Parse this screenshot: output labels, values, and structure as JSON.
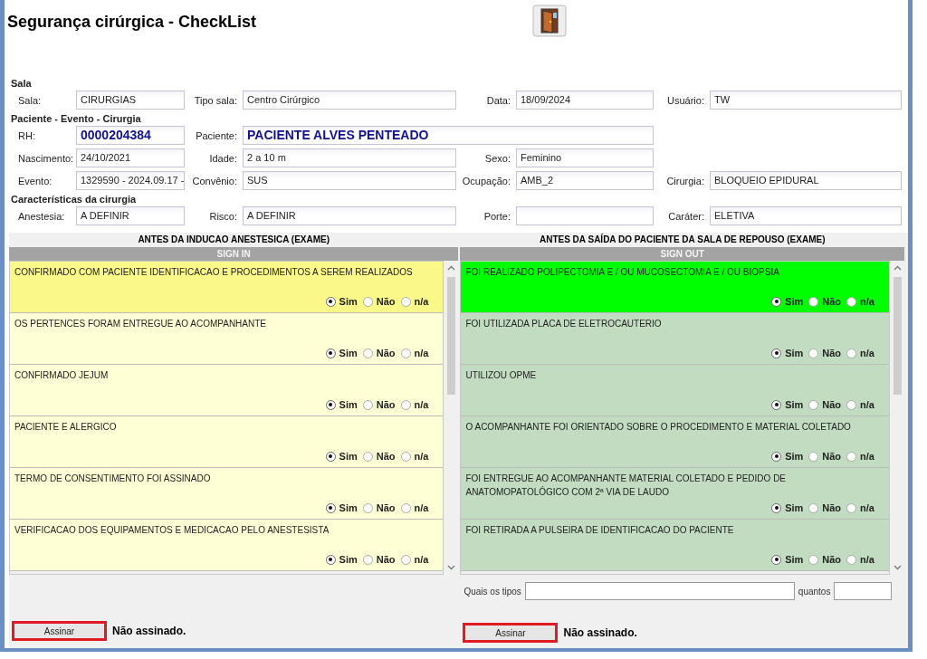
{
  "window": {
    "title": "Segurança cirúrgica - CheckList"
  },
  "form": {
    "sections": [
      {
        "title": "Sala",
        "rows": [
          [
            {
              "label": "Sala:",
              "value": "CIRURGIAS",
              "kind": "plain"
            },
            {
              "label": "Tipo sala:",
              "value": "Centro Cirúrgico",
              "kind": "plain"
            },
            {
              "label": "Data:",
              "value": "18/09/2024",
              "kind": "plain"
            },
            {
              "label": "Usuário:",
              "value": "TW",
              "kind": "plain"
            }
          ]
        ]
      },
      {
        "title": "Paciente - Evento - Cirurgia",
        "rows": [
          [
            {
              "label": "RH:",
              "value": "0000204384",
              "kind": "highlight"
            },
            {
              "label": "Paciente:",
              "value": "PACIENTE ALVES PENTEADO",
              "kind": "highlight"
            }
          ],
          [
            {
              "label": "Nascimento:",
              "value": "24/10/2021",
              "kind": "plain"
            },
            {
              "label": "Idade:",
              "value": "2 a 10 m",
              "kind": "plain"
            },
            {
              "label": "Sexo:",
              "value": "Feminino",
              "kind": "plain"
            }
          ],
          [
            {
              "label": "Evento:",
              "value": "1329590 - 2024.09.17 -",
              "kind": "plain"
            },
            {
              "label": "Convênio:",
              "value": "SUS",
              "kind": "plain"
            },
            {
              "label": "Ocupação:",
              "value": "AMB_2",
              "kind": "plain"
            },
            {
              "label": "Cirurgia:",
              "value": "BLOQUEIO EPIDURAL",
              "kind": "plain"
            }
          ]
        ]
      },
      {
        "title": "Características da cirurgia",
        "rows": [
          [
            {
              "label": "Anestesia:",
              "value": "A DEFINIR",
              "kind": "plain"
            },
            {
              "label": "Risco:",
              "value": "A DEFINIR",
              "kind": "plain"
            },
            {
              "label": "Porte:",
              "kind": "plain"
            },
            {
              "label": "Caráter:",
              "value": "ELETIVA",
              "kind": "plain"
            }
          ]
        ]
      }
    ]
  },
  "panels": [
    {
      "kind": "sign-in",
      "title": "ANTES DA INDUCAO ANESTESICA (EXAME)",
      "subtitle": "SIGN IN",
      "items": [
        {
          "text": "CONFIRMADO COM PACIENTE IDENTIFICACAO E PROCEDIMENTOS A SEREM REALIZADOS",
          "highlighted": true,
          "options": [
            {
              "label": "Sim",
              "selected": true
            },
            {
              "label": "Não",
              "selected": false
            },
            {
              "label": "n/a",
              "selected": false
            }
          ]
        },
        {
          "text": "OS PERTENCES FORAM ENTREGUE AO ACOMPANHANTE",
          "highlighted": false,
          "options": [
            {
              "label": "Sim",
              "selected": true
            },
            {
              "label": "Não",
              "selected": false
            },
            {
              "label": "n/a",
              "selected": false
            }
          ]
        },
        {
          "text": "CONFIRMADO JEJUM",
          "highlighted": false,
          "options": [
            {
              "label": "Sim",
              "selected": true
            },
            {
              "label": "Não",
              "selected": false
            },
            {
              "label": "n/a",
              "selected": false
            }
          ]
        },
        {
          "text": "PACIENTE E ALERGICO",
          "highlighted": false,
          "options": [
            {
              "label": "Sim",
              "selected": true
            },
            {
              "label": "Não",
              "selected": false
            },
            {
              "label": "n/a",
              "selected": false
            }
          ]
        },
        {
          "text": "TERMO DE CONSENTIMENTO FOI ASSINADO",
          "highlighted": false,
          "options": [
            {
              "label": "Sim",
              "selected": true
            },
            {
              "label": "Não",
              "selected": false
            },
            {
              "label": "n/a",
              "selected": false
            }
          ]
        },
        {
          "text": "VERIFICACAO DOS EQUIPAMENTOS E MEDICACAO PELO ANESTESISTA",
          "highlighted": false,
          "options": [
            {
              "label": "Sim",
              "selected": true
            },
            {
              "label": "Não",
              "selected": false
            },
            {
              "label": "n/a",
              "selected": false
            }
          ]
        }
      ],
      "sign_button": "Assinar",
      "sign_status": "Não assinado."
    },
    {
      "kind": "sign-out",
      "title": "ANTES DA SAÍDA DO PACIENTE DA SALA DE REPOUSO (EXAME)",
      "subtitle": "SIGN OUT",
      "items": [
        {
          "text": "FOI REALIZADO POLIPECTOMIA E / OU MUCOSECTOMIA E / OU BIOPSIA",
          "highlighted": true,
          "options": [
            {
              "label": "Sim",
              "selected": true
            },
            {
              "label": "Não",
              "selected": false
            },
            {
              "label": "n/a",
              "selected": false
            }
          ]
        },
        {
          "text": "FOI UTILIZADA PLACA DE ELETROCAUTERIO",
          "highlighted": false,
          "options": [
            {
              "label": "Sim",
              "selected": true
            },
            {
              "label": "Não",
              "selected": false
            },
            {
              "label": "n/a",
              "selected": false
            }
          ]
        },
        {
          "text": "UTILIZOU OPME",
          "highlighted": false,
          "options": [
            {
              "label": "Sim",
              "selected": true
            },
            {
              "label": "Não",
              "selected": false
            },
            {
              "label": "n/a",
              "selected": false
            }
          ]
        },
        {
          "text": "O ACOMPANHANTE FOI ORIENTADO SOBRE O PROCEDIMENTO E MATERIAL COLETADO",
          "highlighted": false,
          "options": [
            {
              "label": "Sim",
              "selected": true
            },
            {
              "label": "Não",
              "selected": false
            },
            {
              "label": "n/a",
              "selected": false
            }
          ]
        },
        {
          "text": "FOI ENTREGUE AO ACOMPANHANTE MATERIAL COLETADO E PEDIDO DE ANATOMOPATOLÓGICO COM 2ª VIA DE LAUDO",
          "highlighted": false,
          "options": [
            {
              "label": "Sim",
              "selected": true
            },
            {
              "label": "Não",
              "selected": false
            },
            {
              "label": "n/a",
              "selected": false
            }
          ]
        },
        {
          "text": "FOI RETIRADA A PULSEIRA DE IDENTIFICACAO DO PACIENTE",
          "highlighted": false,
          "options": [
            {
              "label": "Sim",
              "selected": true
            },
            {
              "label": "Não",
              "selected": false
            },
            {
              "label": "n/a",
              "selected": false
            }
          ]
        }
      ],
      "extra_fields": [
        {
          "label": "Quais os tipos",
          "kind": "wide"
        },
        {
          "label": "quantos",
          "kind": "narrow"
        }
      ],
      "sign_button": "Assinar",
      "sign_status": "Não assinado."
    }
  ]
}
